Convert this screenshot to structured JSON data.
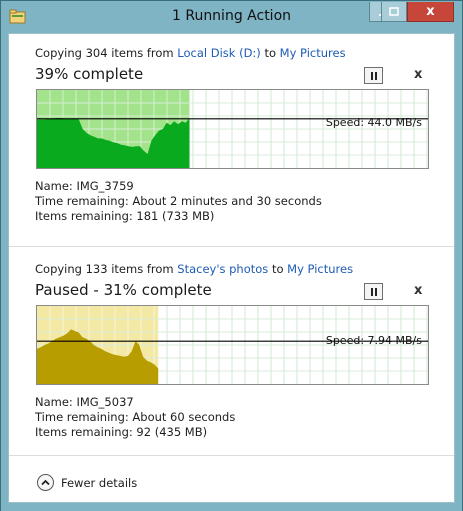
{
  "window": {
    "title": "1 Running Action",
    "close_glyph": "x"
  },
  "operations": [
    {
      "prefix": "Copying 304 items from ",
      "source": "Local Disk (D:)",
      "middle": " to ",
      "destination": "My Pictures",
      "status": "39% complete",
      "progress_percent": 39,
      "paused": false,
      "speed": "Speed: 44.0 MB/s",
      "name_line": "Name:  IMG_3759",
      "time_line": "Time remaining:  About 2 minutes and 30 seconds",
      "items_line": "Items remaining:  181 (733 MB)",
      "colors": {
        "fill": "#0aaa1e",
        "progress_bg": "#a2e38c"
      },
      "throughput": [
        0.62,
        0.62,
        0.62,
        0.63,
        0.63,
        0.64,
        0.64,
        0.64,
        0.63,
        0.63,
        0.64,
        0.62,
        0.5,
        0.45,
        0.42,
        0.4,
        0.38,
        0.38,
        0.36,
        0.35,
        0.33,
        0.32,
        0.3,
        0.29,
        0.28,
        0.27,
        0.28,
        0.28,
        0.22,
        0.18,
        0.35,
        0.42,
        0.48,
        0.5,
        0.58,
        0.55,
        0.6,
        0.56,
        0.6,
        0.58,
        0.64
      ]
    },
    {
      "prefix": "Copying 133 items from ",
      "source": "Stacey's photos",
      "middle": " to ",
      "destination": "My Pictures",
      "status": "Paused - 31% complete",
      "progress_percent": 31,
      "paused": true,
      "speed": "Speed: 7.94 MB/s",
      "name_line": "Name:  IMG_5037",
      "time_line": "Time remaining:  About 60 seconds",
      "items_line": "Items remaining:  92 (435 MB)",
      "colors": {
        "fill": "#b89d00",
        "progress_bg": "#f3e9a4"
      },
      "throughput": [
        0.45,
        0.47,
        0.5,
        0.52,
        0.55,
        0.58,
        0.6,
        0.62,
        0.65,
        0.7,
        0.68,
        0.66,
        0.6,
        0.58,
        0.55,
        0.5,
        0.47,
        0.45,
        0.42,
        0.4,
        0.38,
        0.37,
        0.36,
        0.35,
        0.36,
        0.42,
        0.55,
        0.5,
        0.35,
        0.3,
        0.28,
        0.25,
        0.2
      ]
    }
  ],
  "footer": {
    "label": "Fewer details"
  }
}
